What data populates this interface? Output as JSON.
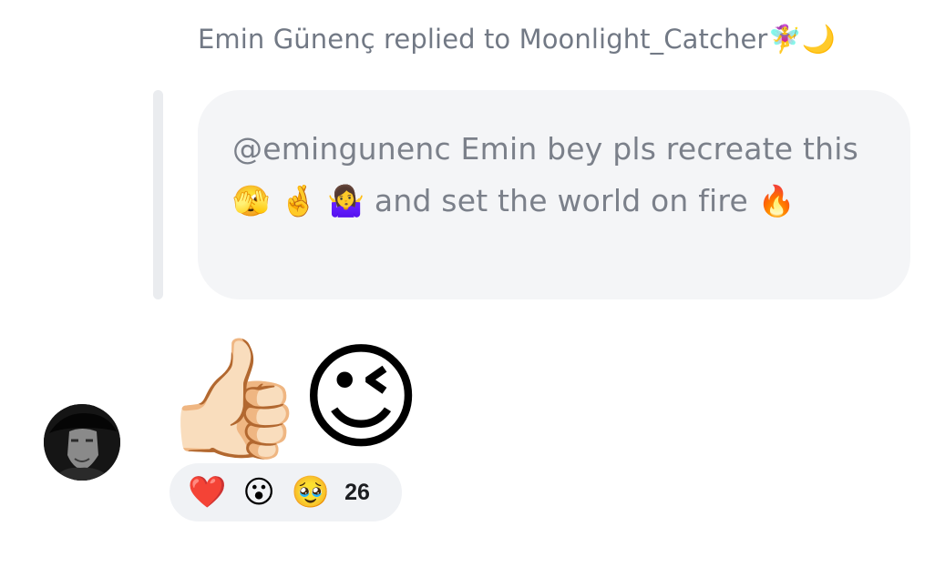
{
  "reply": {
    "header_text": "Emin Günenç replied to Moonlight_Catcher",
    "header_emojis": "🧚‍♀️🌙",
    "quoted_message": "@emingunenc Emin bey pls recreate this 🫣 🤞 🤷‍♀️ and set the world on fire 🔥"
  },
  "message": {
    "content": "👍🏻😉"
  },
  "reactions": {
    "emojis": [
      "❤️",
      "😮",
      "🥹"
    ],
    "count": "26"
  },
  "colors": {
    "secondary_text": "#727985",
    "bubble_bg": "#f4f5f7",
    "quote_bar": "#eaecef",
    "reaction_pill_bg": "#f0f2f5"
  },
  "icons": {
    "avatar": "user-avatar"
  }
}
